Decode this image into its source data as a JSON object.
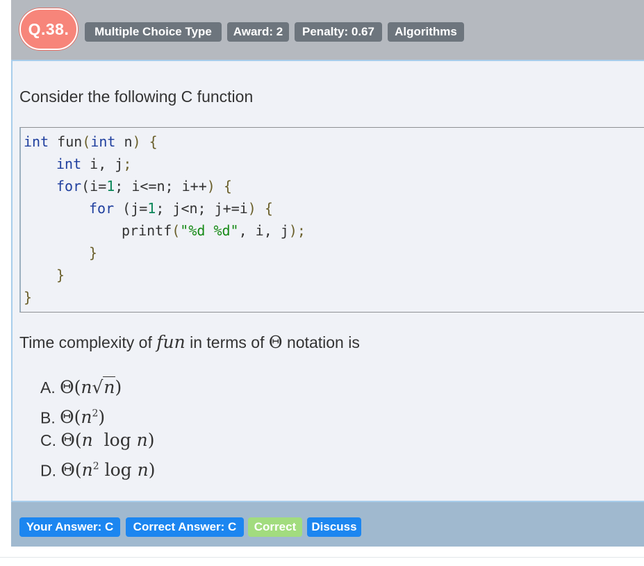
{
  "header": {
    "question_number": "Q.38.",
    "tags": [
      "Multiple Choice Type",
      "Award: 2",
      "Penalty: 0.67",
      "Algorithms"
    ]
  },
  "question": {
    "prompt": "Consider the following C function",
    "code": {
      "line1_kw": "int",
      "line1_name": " fun",
      "line1_paren": "(",
      "line1_kw2": "int",
      "line1_rest": " n",
      "line1_close": ") {",
      "line2_kw": "int",
      "line2_rest": " i, j",
      "line2_semi": ";",
      "line3_kw": "for",
      "line3_a": "(i=",
      "line3_n1": "1",
      "line3_b": "; i<=n; i++",
      "line3_c": ") {",
      "line4_kw": "for",
      "line4_a": " (j=",
      "line4_n1": "1",
      "line4_b": "; j<n; j+=i",
      "line4_c": ") {",
      "line5_fn": "printf",
      "line5_p": "(",
      "line5_str": "\"%d %d\"",
      "line5_rest": ", i, j",
      "line5_end": ");",
      "close_inner": "}",
      "close_outer": "}",
      "close_fn": "}"
    },
    "question_prefix": "Time complexity of ",
    "question_var": "fun",
    "question_mid": " in terms of ",
    "question_theta": "Θ",
    "question_suffix": " notation is",
    "options": [
      {
        "label": "A.",
        "math": "Θ(n√n)"
      },
      {
        "label": "B.",
        "math": "Θ(n²)"
      },
      {
        "label": "C.",
        "math": "Θ(n log n)"
      },
      {
        "label": "D.",
        "math": "Θ(n² log n)"
      }
    ]
  },
  "footer": {
    "your_answer": "Your Answer: C",
    "correct_answer": "Correct Answer: C",
    "status": "Correct",
    "discuss": "Discuss"
  },
  "colors": {
    "badge": "#f7857a",
    "tag": "#6d757d",
    "header_bg": "#b5b9bf",
    "panel_bg": "#f0f2f7",
    "footer_bg": "#a0b9cf",
    "primary": "#1c86f0",
    "success": "#a2dc7e"
  }
}
